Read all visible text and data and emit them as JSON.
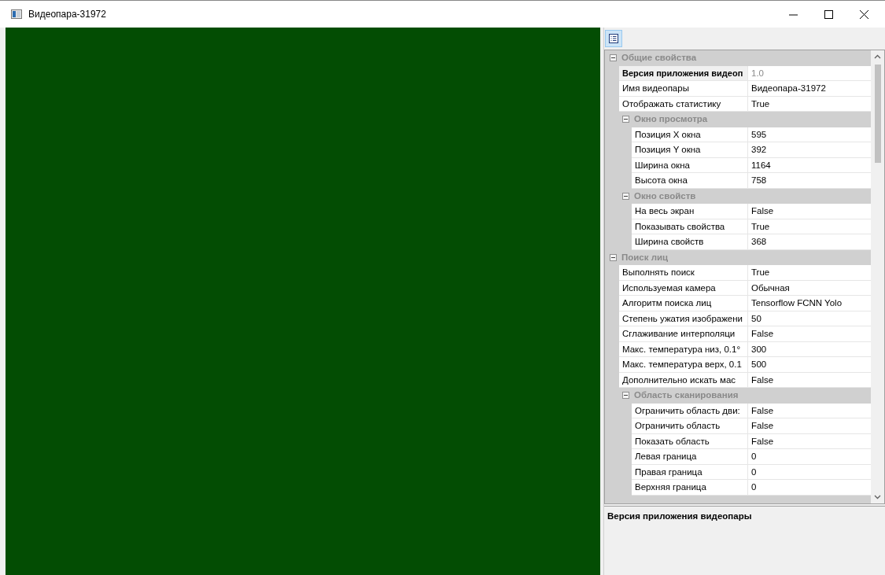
{
  "window": {
    "title": "Видеопара-31972"
  },
  "toolbar": {
    "categorized_button": {
      "selected": true
    }
  },
  "property_grid": {
    "items": [
      {
        "kind": "category",
        "label": "Общие свойства",
        "expanded": true,
        "items": [
          {
            "kind": "property",
            "name": "Версия приложения видеоп",
            "value": "1.0",
            "selected": true,
            "readonly": true
          },
          {
            "kind": "property",
            "name": "Имя видеопары",
            "value": "Видеопара-31972",
            "selected": false,
            "readonly": false
          },
          {
            "kind": "property",
            "name": "Отображать статистику",
            "value": "True",
            "selected": false,
            "readonly": false
          },
          {
            "kind": "category",
            "label": "Окно просмотра",
            "expanded": true,
            "items": [
              {
                "kind": "property",
                "name": "Позиция X окна",
                "value": "595",
                "selected": false,
                "readonly": false
              },
              {
                "kind": "property",
                "name": "Позиция Y окна",
                "value": "392",
                "selected": false,
                "readonly": false
              },
              {
                "kind": "property",
                "name": "Ширина окна",
                "value": "1164",
                "selected": false,
                "readonly": false
              },
              {
                "kind": "property",
                "name": "Высота окна",
                "value": "758",
                "selected": false,
                "readonly": false
              }
            ]
          },
          {
            "kind": "category",
            "label": "Окно свойств",
            "expanded": true,
            "items": [
              {
                "kind": "property",
                "name": "На весь экран",
                "value": "False",
                "selected": false,
                "readonly": false
              },
              {
                "kind": "property",
                "name": "Показывать свойства",
                "value": "True",
                "selected": false,
                "readonly": false
              },
              {
                "kind": "property",
                "name": "Ширина свойств",
                "value": "368",
                "selected": false,
                "readonly": false
              }
            ]
          }
        ]
      },
      {
        "kind": "category",
        "label": "Поиск лиц",
        "expanded": true,
        "items": [
          {
            "kind": "property",
            "name": "Выполнять поиск",
            "value": "True",
            "selected": false,
            "readonly": false
          },
          {
            "kind": "property",
            "name": "Используемая камера",
            "value": "Обычная",
            "selected": false,
            "readonly": false
          },
          {
            "kind": "property",
            "name": "Алгоритм поиска лиц",
            "value": "Tensorflow FCNN Yolo",
            "selected": false,
            "readonly": false
          },
          {
            "kind": "property",
            "name": "Степень ужатия изображени",
            "value": "50",
            "selected": false,
            "readonly": false
          },
          {
            "kind": "property",
            "name": "Сглаживание интерполяци",
            "value": "False",
            "selected": false,
            "readonly": false
          },
          {
            "kind": "property",
            "name": "Макс. температура низ, 0.1°",
            "value": "300",
            "selected": false,
            "readonly": false
          },
          {
            "kind": "property",
            "name": "Макс. температура верх, 0.1",
            "value": "500",
            "selected": false,
            "readonly": false
          },
          {
            "kind": "property",
            "name": "Дополнительно искать мас",
            "value": "False",
            "selected": false,
            "readonly": false
          },
          {
            "kind": "category",
            "label": "Область сканирования",
            "expanded": true,
            "items": [
              {
                "kind": "property",
                "name": "Ограничить область дви:",
                "value": "False",
                "selected": false,
                "readonly": false
              },
              {
                "kind": "property",
                "name": "Ограничить область",
                "value": "False",
                "selected": false,
                "readonly": false
              },
              {
                "kind": "property",
                "name": "Показать область",
                "value": "False",
                "selected": false,
                "readonly": false
              },
              {
                "kind": "property",
                "name": "Левая граница",
                "value": "0",
                "selected": false,
                "readonly": false
              },
              {
                "kind": "property",
                "name": "Правая граница",
                "value": "0",
                "selected": false,
                "readonly": false
              },
              {
                "kind": "property",
                "name": "Верхняя граница",
                "value": "0",
                "selected": false,
                "readonly": false
              }
            ]
          }
        ]
      }
    ]
  },
  "description": {
    "title": "Версия приложения видеопары"
  }
}
